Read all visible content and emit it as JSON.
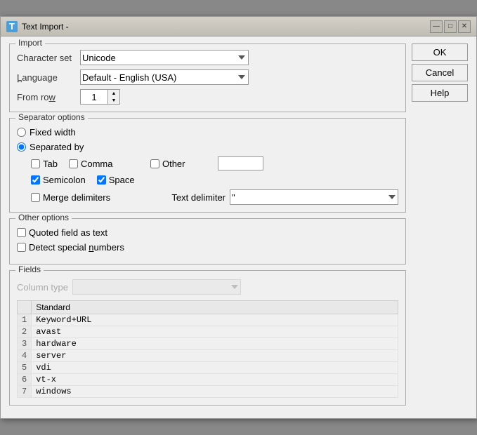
{
  "window": {
    "title": "Text Import -",
    "icon": "T"
  },
  "titlebar": {
    "minimize": "—",
    "maximize": "□",
    "close": "✕"
  },
  "buttons": {
    "ok": "OK",
    "cancel": "Cancel",
    "help": "Help"
  },
  "import": {
    "label": "Import",
    "character_set_label": "Character set",
    "character_set_value": "Unicode",
    "language_label": "Language",
    "language_value": "Default - English (USA)",
    "from_row_label": "From row",
    "from_row_value": "1"
  },
  "separator_options": {
    "label": "Separator options",
    "fixed_width_label": "Fixed width",
    "separated_by_label": "Separated by",
    "tab_label": "Tab",
    "tab_checked": false,
    "comma_label": "Comma",
    "comma_checked": false,
    "other_label": "Other",
    "other_checked": false,
    "other_value": "",
    "semicolon_label": "Semicolon",
    "semicolon_checked": true,
    "space_label": "Space",
    "space_checked": true,
    "merge_label": "Merge delimiters",
    "merge_checked": false,
    "text_delimiter_label": "Text delimiter",
    "text_delimiter_value": "\""
  },
  "other_options": {
    "label": "Other options",
    "quoted_field_label": "Quoted field as text",
    "quoted_field_checked": false,
    "detect_special_label": "Detect special numbers",
    "detect_special_checked": false
  },
  "fields": {
    "label": "Fields",
    "column_type_label": "Column type",
    "column_type_value": "",
    "table_header_num": "",
    "table_header_standard": "Standard",
    "rows": [
      {
        "num": "1",
        "value": "Keyword+URL"
      },
      {
        "num": "2",
        "value": "avast"
      },
      {
        "num": "3",
        "value": "hardware"
      },
      {
        "num": "4",
        "value": "server"
      },
      {
        "num": "5",
        "value": "vdi"
      },
      {
        "num": "6",
        "value": "vt-x"
      },
      {
        "num": "7",
        "value": "windows"
      }
    ]
  }
}
